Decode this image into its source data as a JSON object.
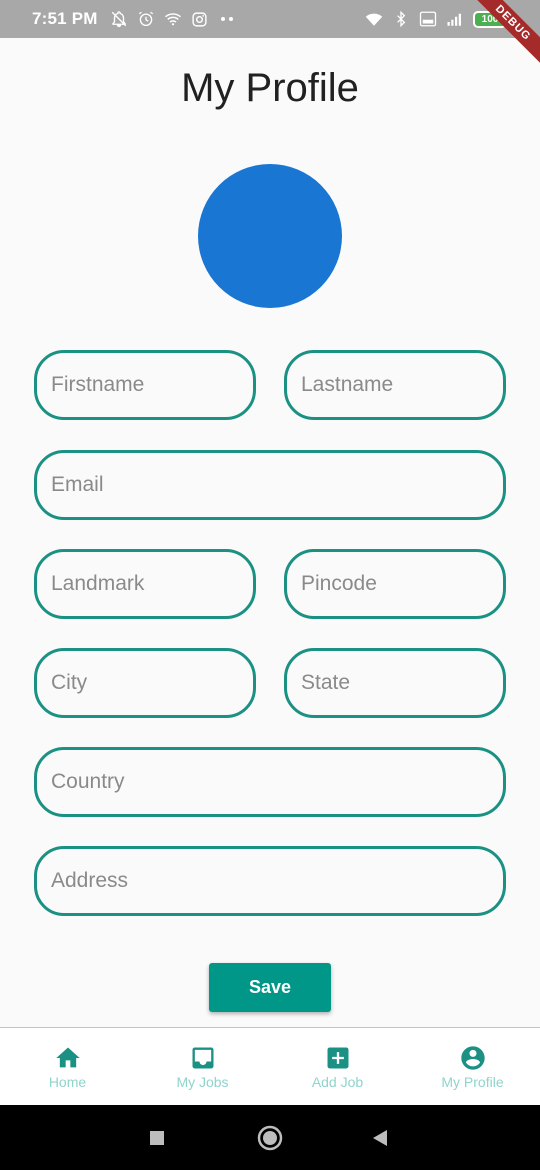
{
  "status_bar": {
    "time": "7:51 PM",
    "battery_level": "100"
  },
  "debug_banner": "DEBUG",
  "page": {
    "title": "My Profile"
  },
  "form": {
    "firstname_placeholder": "Firstname",
    "lastname_placeholder": "Lastname",
    "email_placeholder": "Email",
    "landmark_placeholder": "Landmark",
    "pincode_placeholder": "Pincode",
    "city_placeholder": "City",
    "state_placeholder": "State",
    "country_placeholder": "Country",
    "address_placeholder": "Address",
    "save_label": "Save"
  },
  "bottom_nav": {
    "items": [
      {
        "label": "Home",
        "icon": "home-icon"
      },
      {
        "label": "My Jobs",
        "icon": "inbox-icon"
      },
      {
        "label": "Add Job",
        "icon": "add-box-icon"
      },
      {
        "label": "My Profile",
        "icon": "account-circle-icon"
      }
    ]
  },
  "colors": {
    "accent": "#1b9184",
    "avatar": "#1976d2",
    "button": "#009688"
  }
}
